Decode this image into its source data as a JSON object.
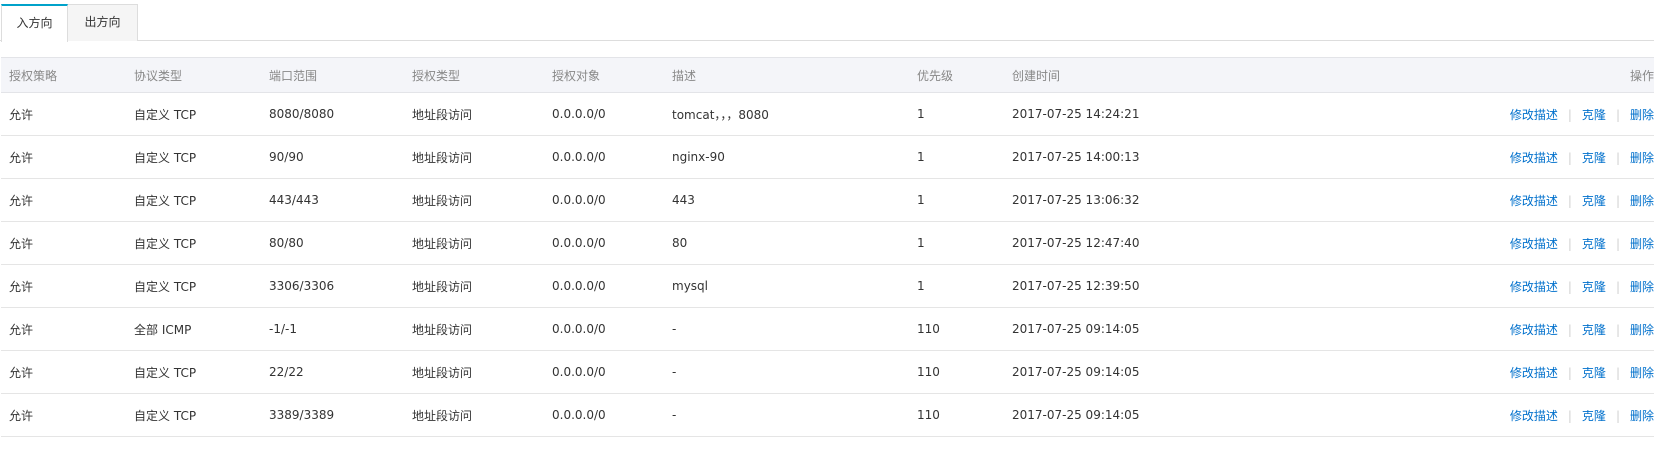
{
  "tabs": [
    {
      "label": "入方向",
      "active": true
    },
    {
      "label": "出方向",
      "active": false
    }
  ],
  "table": {
    "columns": [
      "授权策略",
      "协议类型",
      "端口范围",
      "授权类型",
      "授权对象",
      "描述",
      "优先级",
      "创建时间",
      "操作"
    ],
    "actions": [
      "修改描述",
      "克隆",
      "删除"
    ],
    "rows": [
      [
        "允许",
        "自定义 TCP",
        "8080/8080",
        "地址段访问",
        "0.0.0.0/0",
        "tomcat，，，8080",
        "1",
        "2017-07-25 14:24:21"
      ],
      [
        "允许",
        "自定义 TCP",
        "90/90",
        "地址段访问",
        "0.0.0.0/0",
        "nginx-90",
        "1",
        "2017-07-25 14:00:13"
      ],
      [
        "允许",
        "自定义 TCP",
        "443/443",
        "地址段访问",
        "0.0.0.0/0",
        "443",
        "1",
        "2017-07-25 13:06:32"
      ],
      [
        "允许",
        "自定义 TCP",
        "80/80",
        "地址段访问",
        "0.0.0.0/0",
        "80",
        "1",
        "2017-07-25 12:47:40"
      ],
      [
        "允许",
        "自定义 TCP",
        "3306/3306",
        "地址段访问",
        "0.0.0.0/0",
        "mysql",
        "1",
        "2017-07-25 12:39:50"
      ],
      [
        "允许",
        "全部 ICMP",
        "-1/-1",
        "地址段访问",
        "0.0.0.0/0",
        "-",
        "110",
        "2017-07-25 09:14:05"
      ],
      [
        "允许",
        "自定义 TCP",
        "22/22",
        "地址段访问",
        "0.0.0.0/0",
        "-",
        "110",
        "2017-07-25 09:14:05"
      ],
      [
        "允许",
        "自定义 TCP",
        "3389/3389",
        "地址段访问",
        "0.0.0.0/0",
        "-",
        "110",
        "2017-07-25 09:14:05"
      ]
    ]
  },
  "colors": {
    "accent": "#00a2ca",
    "link": "#0070cc",
    "header_bg": "#f4f5f9"
  }
}
